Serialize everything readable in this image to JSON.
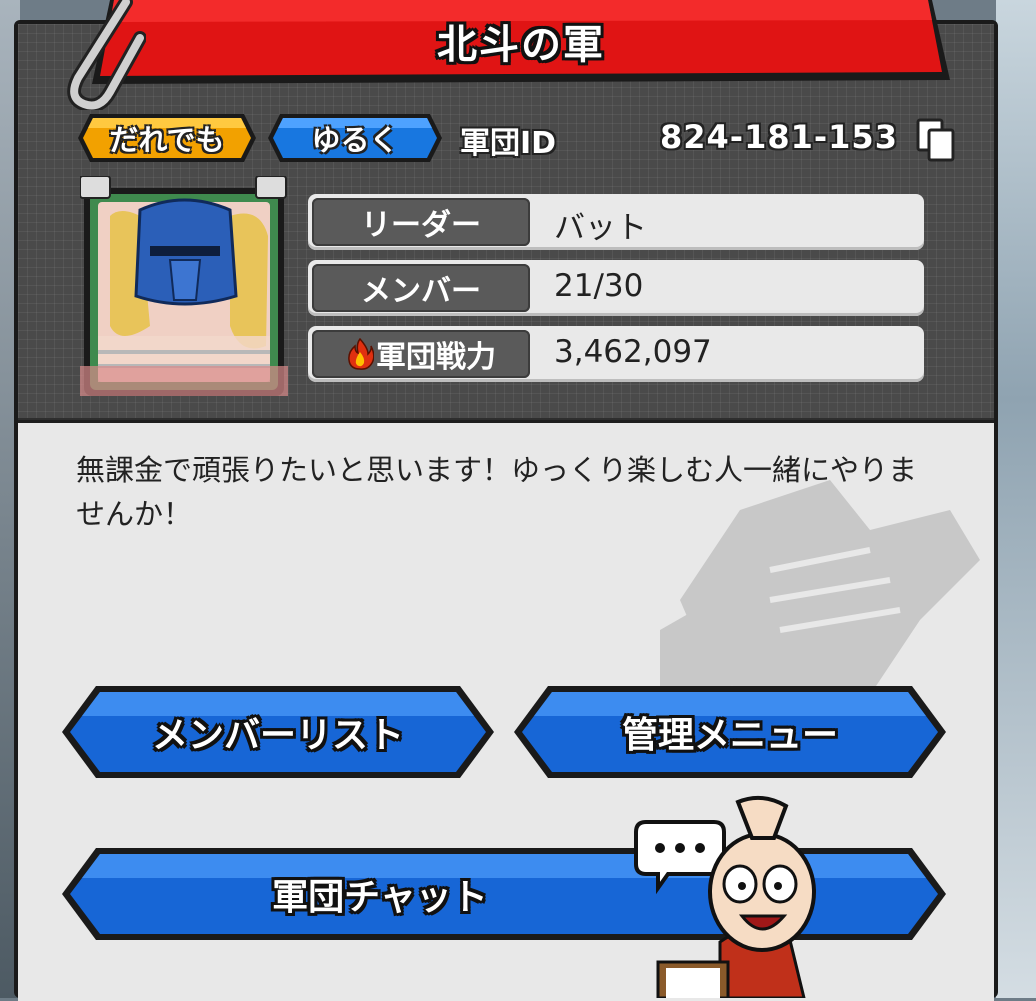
{
  "guild": {
    "name": "北斗の軍",
    "tags": [
      "だれでも",
      "ゆるく"
    ],
    "id_label": "軍団ID",
    "id_value": "824-181-153"
  },
  "info_rows": [
    {
      "label": "リーダー",
      "value": "バット"
    },
    {
      "label": "メンバー",
      "value": "21/30"
    },
    {
      "label": "軍団戦力",
      "value": "3,462,097"
    }
  ],
  "description": "無課金で頑張りたいと思います！ゆっくり楽しむ人一緒にやりませんか！",
  "buttons": {
    "member_list": "メンバーリスト",
    "admin_menu": "管理メニュー",
    "guild_chat": "軍団チャット"
  },
  "icons": {
    "copy": "copy-icon",
    "fire": "fire-icon",
    "speech": "speech-bubble-icon"
  },
  "colors": {
    "title_red": "#e01414",
    "tag_orange": "#f2a100",
    "tag_blue": "#1877e0",
    "button_blue": "#1766d6"
  }
}
